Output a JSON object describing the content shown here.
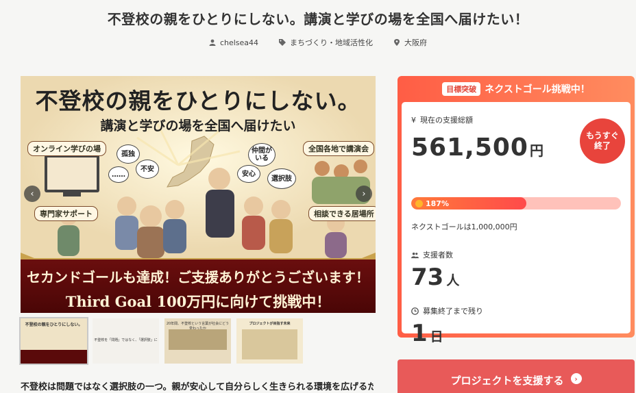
{
  "project": {
    "title": "不登校の親をひとりにしない。講演と学びの場を全国へ届けたい！",
    "author": "chelsea44",
    "category": "まちづくり・地域活性化",
    "location": "大阪府",
    "intro": "不登校は問題ではなく選択肢の一つ。親が安心して自分らしく生きられる環境を広げるた"
  },
  "hero": {
    "title": "不登校の親をひとりにしない。",
    "subtitle": "講演と学びの場を全国へ届けたい",
    "labels": {
      "online": "オンライン学びの場",
      "nationwide": "全国各地で講演会",
      "expert": "専門家サポート",
      "place": "相談できる居場所"
    },
    "bubbles": [
      "孤独",
      "不安",
      "……",
      "仲間がいる",
      "安心",
      "選択肢"
    ],
    "banner_line1": "セカンドゴールも達成！ご支援ありがとうございます！",
    "banner_line2": "Third Goal 100万円に向けて挑戦中！",
    "prev_glyph": "‹",
    "next_glyph": "›"
  },
  "thumbnails": [
    {
      "text": "不登校の親をひとりにしない。"
    },
    {
      "text": "不登校を「問題」ではなく、「選択肢」に"
    },
    {
      "text": "20年間、不登校という言葉が社会にどう変わったか"
    },
    {
      "text": "プロジェクトが目指す未来"
    }
  ],
  "card": {
    "badge": "目標突破",
    "header": "ネクストゴール挑戦中！",
    "total_label": "現在の支援総額",
    "total_value": "561,500",
    "total_unit": "円",
    "soon_line1": "もうすぐ",
    "soon_line2": "終了",
    "progress_percent": 187,
    "progress_text": "187%",
    "progress_fill_fraction": 0.55,
    "next_goal": "ネクストゴールは1,000,000円",
    "supporters_label": "支援者数",
    "supporters_value": "73",
    "supporters_unit": "人",
    "remaining_label": "募集終了まで残り",
    "remaining_value": "1",
    "remaining_unit": "日"
  },
  "support_button": "プロジェクトを支援する",
  "colors": {
    "accent": "#e85a59",
    "card_gradient_start": "#ff5d45",
    "card_gradient_end": "#ff8c5f",
    "banner": "#5a0a0a"
  }
}
